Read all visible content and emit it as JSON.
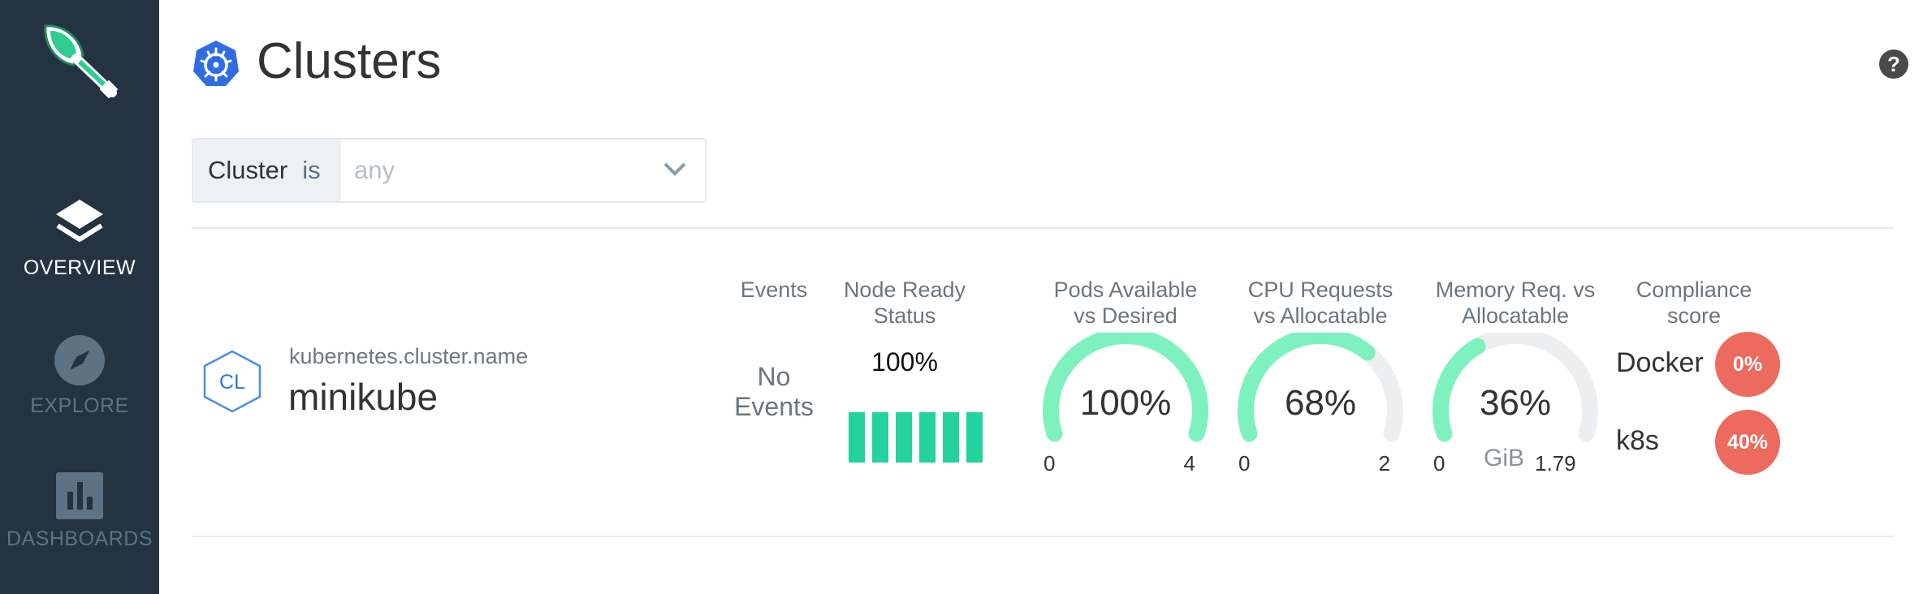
{
  "sidebar": {
    "items": [
      {
        "label": "OVERVIEW",
        "icon": "layers-icon",
        "active": true
      },
      {
        "label": "EXPLORE",
        "icon": "compass-icon",
        "active": false
      },
      {
        "label": "DASHBOARDS",
        "icon": "bar-chart-icon",
        "active": false
      }
    ]
  },
  "header": {
    "title": "Clusters",
    "help": "?"
  },
  "filter": {
    "key": "Cluster",
    "operator": "is",
    "placeholder": "any"
  },
  "cluster": {
    "badge": "CL",
    "key": "kubernetes.cluster.name",
    "name": "minikube",
    "events": {
      "title": "Events",
      "value_line1": "No",
      "value_line2": "Events"
    },
    "node_ready": {
      "title_line1": "Node Ready",
      "title_line2": "Status",
      "value": "100%",
      "bar_count": 6
    },
    "pods": {
      "title_line1": "Pods Available",
      "title_line2": "vs Desired",
      "value": "100%",
      "fraction": 1.0,
      "min": "0",
      "max": "4"
    },
    "cpu": {
      "title_line1": "CPU Requests",
      "title_line2": "vs Allocatable",
      "value": "68%",
      "fraction": 0.68,
      "min": "0",
      "max": "2"
    },
    "memory": {
      "title_line1": "Memory Req. vs",
      "title_line2": "Allocatable",
      "value": "36%",
      "fraction": 0.36,
      "min": "0",
      "unit": "GiB",
      "max": "1.79"
    },
    "compliance": {
      "title_line1": "Compliance",
      "title_line2": "score",
      "items": [
        {
          "label": "Docker",
          "value": "0%"
        },
        {
          "label": "k8s",
          "value": "40%"
        }
      ]
    }
  },
  "colors": {
    "sidebar_bg": "#233341",
    "gauge_fill": "#7df2be",
    "gauge_track": "#eceef0",
    "node_bar": "#23d39b",
    "badge_red": "#ec6a5e",
    "k8s_blue": "#326ce5"
  }
}
